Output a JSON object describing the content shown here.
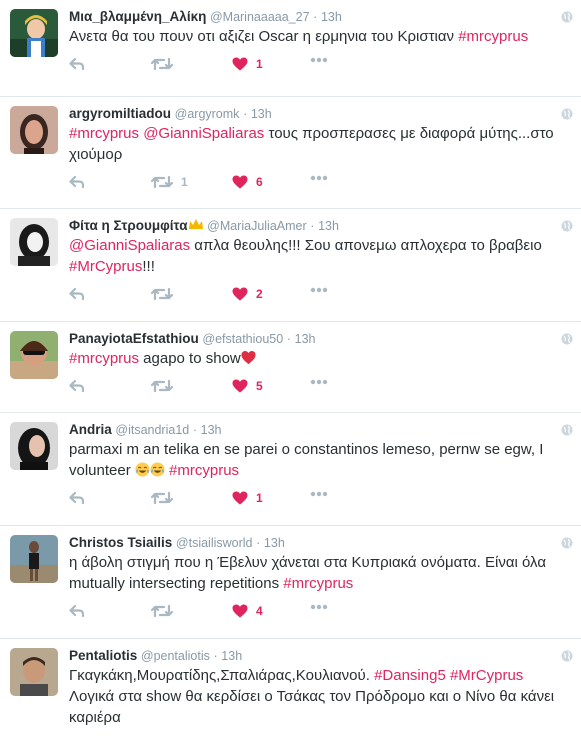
{
  "colors": {
    "accent": "#e0245e",
    "muted": "#aab8c2",
    "name": "#292f33",
    "meta": "#8899a6"
  },
  "tweets": [
    {
      "name": "Μια_βλαμμένη_Αλίκη",
      "handle": "@Marinaaaaa_27",
      "dot": "·",
      "time": "13h",
      "text": [
        {
          "t": "Ανετα θα του πουν οτι αξιζει Oscar η ερμηνια του Κριστιαν "
        },
        {
          "t": "#mrcyprus",
          "tag": true
        }
      ],
      "retweets": "",
      "likes": "1"
    },
    {
      "name": "argyromiltiadou",
      "handle": "@argyromk",
      "dot": "·",
      "time": "13h",
      "text": [
        {
          "t": "#mrcyprus",
          "tag": true
        },
        {
          "t": " "
        },
        {
          "t": "@GianniSpaliaras",
          "tag": true
        },
        {
          "t": "  τους προσπερασες με διαφορά μύτης...στο χιούμορ"
        }
      ],
      "retweets": "1",
      "likes": "6"
    },
    {
      "name": "Φίτα η Στρουμφίτα",
      "handle": "@MariaJuliaAmer",
      "dot": "·",
      "time": "13h",
      "crown_icon": "crown-icon",
      "text": [
        {
          "t": "@GianniSpaliaras",
          "tag": true
        },
        {
          "t": " απλα θεουλης!!! Σου απονεμω απλοχερα το βραβειο "
        },
        {
          "t": "#MrCyprus",
          "tag": true
        },
        {
          "t": "!!!"
        }
      ],
      "retweets": "",
      "likes": "2"
    },
    {
      "name": "PanayiotaEfstathiou",
      "handle": "@efstathiou50",
      "dot": "·",
      "time": "13h",
      "text": [
        {
          "t": "#mrcyprus",
          "tag": true
        },
        {
          "t": " agapo to show"
        },
        {
          "emoji": "red-heart-emoji"
        }
      ],
      "retweets": "",
      "likes": "5"
    },
    {
      "name": "Andria",
      "handle": "@itsandria1d",
      "dot": "·",
      "time": "13h",
      "text": [
        {
          "t": "parmaxi m an telika en se parei o constantinos lemeso, pernw se egw, I volunteer "
        },
        {
          "emoji": "tears-of-joy-emoji"
        },
        {
          "emoji": "tears-of-joy-emoji"
        },
        {
          "t": " "
        },
        {
          "t": "#mrcyprus",
          "tag": true
        }
      ],
      "retweets": "",
      "likes": "1"
    },
    {
      "name": "Christos Tsiailis",
      "handle": "@tsiailisworld",
      "dot": "·",
      "time": "13h",
      "text": [
        {
          "t": "η άβολη στιγμή που η Έβελυν χάνεται στα Κυπριακά ονόματα. Είναι όλα mutually intersecting repetitions  "
        },
        {
          "t": "#mrcyprus",
          "tag": true
        }
      ],
      "retweets": "",
      "likes": "4"
    },
    {
      "name": "Pentaliotis",
      "handle": "@pentaliotis",
      "dot": "·",
      "time": "13h",
      "text": [
        {
          "t": "Γκαγκάκη,Μουρατίδης,Σπαλιάρας,Κουλιανού.  "
        },
        {
          "t": "#Dansing5",
          "tag": true
        },
        {
          "t": " "
        },
        {
          "t": "#MrCyprus",
          "tag": true
        },
        {
          "t": "  Λογικά στα show θα κερδίσει ο Τσάκας τον Πρόδρομο και ο Νίνο θα κάνει καριέρα"
        }
      ],
      "retweets": "",
      "likes": ""
    }
  ]
}
